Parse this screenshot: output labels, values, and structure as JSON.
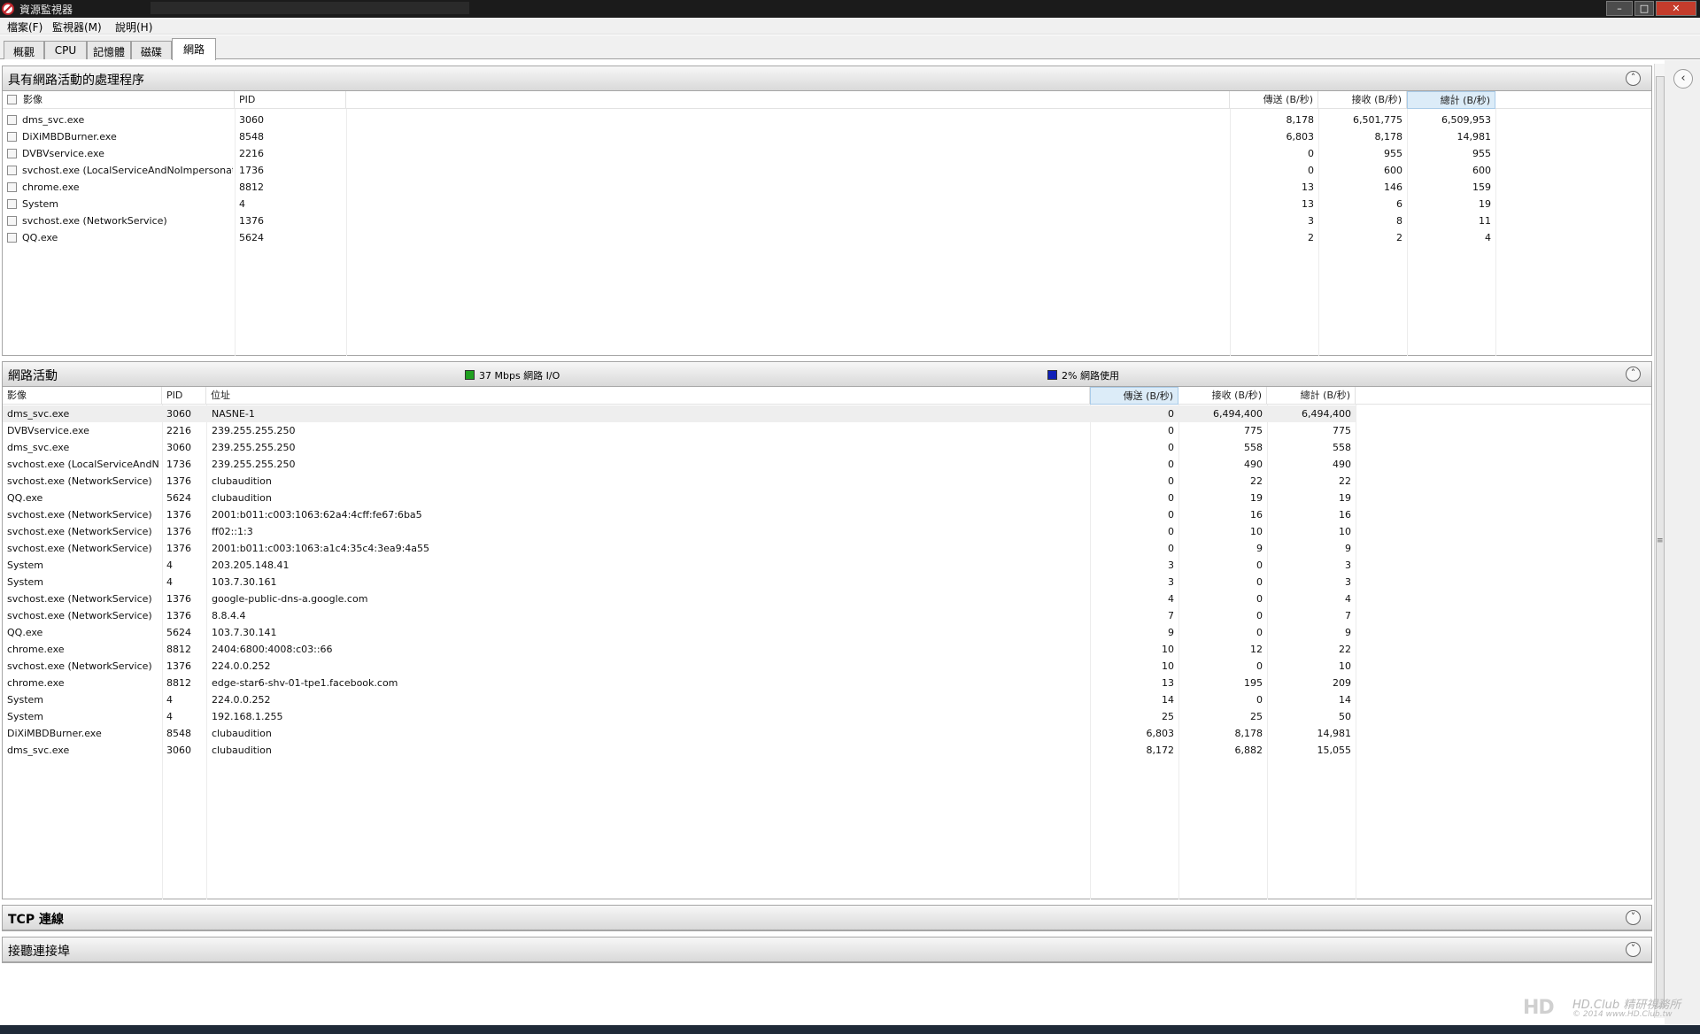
{
  "window": {
    "title": "資源監視器"
  },
  "menu": [
    "檔案(F)",
    "監視器(M)",
    "說明(H)"
  ],
  "tabs": [
    {
      "label": "概觀",
      "active": false
    },
    {
      "label": "CPU",
      "active": false
    },
    {
      "label": "記憶體",
      "active": false
    },
    {
      "label": "磁碟",
      "active": false
    },
    {
      "label": "網路",
      "active": true
    }
  ],
  "processes": {
    "title": "具有網路活動的處理程序",
    "columns": [
      "影像",
      "PID",
      "傳送 (B/秒)",
      "接收 (B/秒)",
      "總計 (B/秒)"
    ],
    "sorted_column": "總計 (B/秒)",
    "rows": [
      {
        "image": "dms_svc.exe",
        "pid": "3060",
        "send": "8,178",
        "recv": "6,501,775",
        "total": "6,509,953"
      },
      {
        "image": "DiXiMBDBurner.exe",
        "pid": "8548",
        "send": "6,803",
        "recv": "8,178",
        "total": "14,981"
      },
      {
        "image": "DVBVservice.exe",
        "pid": "2216",
        "send": "0",
        "recv": "955",
        "total": "955"
      },
      {
        "image": "svchost.exe (LocalServiceAndNoImpersonat...",
        "pid": "1736",
        "send": "0",
        "recv": "600",
        "total": "600"
      },
      {
        "image": "chrome.exe",
        "pid": "8812",
        "send": "13",
        "recv": "146",
        "total": "159"
      },
      {
        "image": "System",
        "pid": "4",
        "send": "13",
        "recv": "6",
        "total": "19"
      },
      {
        "image": "svchost.exe (NetworkService)",
        "pid": "1376",
        "send": "3",
        "recv": "8",
        "total": "11"
      },
      {
        "image": "QQ.exe",
        "pid": "5624",
        "send": "2",
        "recv": "2",
        "total": "4"
      }
    ]
  },
  "network": {
    "title": "網路活動",
    "io_label": "37 Mbps 網路 I/O",
    "usage_label": "2% 網路使用",
    "io_color": "#1fa01f",
    "usage_color": "#1020b8",
    "columns": [
      "影像",
      "PID",
      "位址",
      "傳送 (B/秒)",
      "接收 (B/秒)",
      "總計 (B/秒)"
    ],
    "sorted_column": "傳送 (B/秒)",
    "rows": [
      {
        "image": "dms_svc.exe",
        "pid": "3060",
        "addr": "NASNE-1",
        "send": "0",
        "recv": "6,494,400",
        "total": "6,494,400"
      },
      {
        "image": "DVBVservice.exe",
        "pid": "2216",
        "addr": "239.255.255.250",
        "send": "0",
        "recv": "775",
        "total": "775"
      },
      {
        "image": "dms_svc.exe",
        "pid": "3060",
        "addr": "239.255.255.250",
        "send": "0",
        "recv": "558",
        "total": "558"
      },
      {
        "image": "svchost.exe (LocalServiceAndN...",
        "pid": "1736",
        "addr": "239.255.255.250",
        "send": "0",
        "recv": "490",
        "total": "490"
      },
      {
        "image": "svchost.exe (NetworkService)",
        "pid": "1376",
        "addr": "clubaudition",
        "send": "0",
        "recv": "22",
        "total": "22"
      },
      {
        "image": "QQ.exe",
        "pid": "5624",
        "addr": "clubaudition",
        "send": "0",
        "recv": "19",
        "total": "19"
      },
      {
        "image": "svchost.exe (NetworkService)",
        "pid": "1376",
        "addr": "2001:b011:c003:1063:62a4:4cff:fe67:6ba5",
        "send": "0",
        "recv": "16",
        "total": "16"
      },
      {
        "image": "svchost.exe (NetworkService)",
        "pid": "1376",
        "addr": "ff02::1:3",
        "send": "0",
        "recv": "10",
        "total": "10"
      },
      {
        "image": "svchost.exe (NetworkService)",
        "pid": "1376",
        "addr": "2001:b011:c003:1063:a1c4:35c4:3ea9:4a55",
        "send": "0",
        "recv": "9",
        "total": "9"
      },
      {
        "image": "System",
        "pid": "4",
        "addr": "203.205.148.41",
        "send": "3",
        "recv": "0",
        "total": "3"
      },
      {
        "image": "System",
        "pid": "4",
        "addr": "103.7.30.161",
        "send": "3",
        "recv": "0",
        "total": "3"
      },
      {
        "image": "svchost.exe (NetworkService)",
        "pid": "1376",
        "addr": "google-public-dns-a.google.com",
        "send": "4",
        "recv": "0",
        "total": "4"
      },
      {
        "image": "svchost.exe (NetworkService)",
        "pid": "1376",
        "addr": "8.8.4.4",
        "send": "7",
        "recv": "0",
        "total": "7"
      },
      {
        "image": "QQ.exe",
        "pid": "5624",
        "addr": "103.7.30.141",
        "send": "9",
        "recv": "0",
        "total": "9"
      },
      {
        "image": "chrome.exe",
        "pid": "8812",
        "addr": "2404:6800:4008:c03::66",
        "send": "10",
        "recv": "12",
        "total": "22"
      },
      {
        "image": "svchost.exe (NetworkService)",
        "pid": "1376",
        "addr": "224.0.0.252",
        "send": "10",
        "recv": "0",
        "total": "10"
      },
      {
        "image": "chrome.exe",
        "pid": "8812",
        "addr": "edge-star6-shv-01-tpe1.facebook.com",
        "send": "13",
        "recv": "195",
        "total": "209"
      },
      {
        "image": "System",
        "pid": "4",
        "addr": "224.0.0.252",
        "send": "14",
        "recv": "0",
        "total": "14"
      },
      {
        "image": "System",
        "pid": "4",
        "addr": "192.168.1.255",
        "send": "25",
        "recv": "25",
        "total": "50"
      },
      {
        "image": "DiXiMBDBurner.exe",
        "pid": "8548",
        "addr": "clubaudition",
        "send": "6,803",
        "recv": "8,178",
        "total": "14,981"
      },
      {
        "image": "dms_svc.exe",
        "pid": "3060",
        "addr": "clubaudition",
        "send": "8,172",
        "recv": "6,882",
        "total": "15,055"
      }
    ]
  },
  "tcp": {
    "title": "TCP 連線"
  },
  "listening": {
    "title": "接聽連接埠"
  },
  "watermark": {
    "brand": "HD.Club 精研視務所",
    "sub": "© 2014  www.HD.Club.tw"
  },
  "icons": {
    "expand": "chevron-down-icon",
    "collapse": "chevron-up-icon",
    "side": "chevron-left-icon"
  }
}
